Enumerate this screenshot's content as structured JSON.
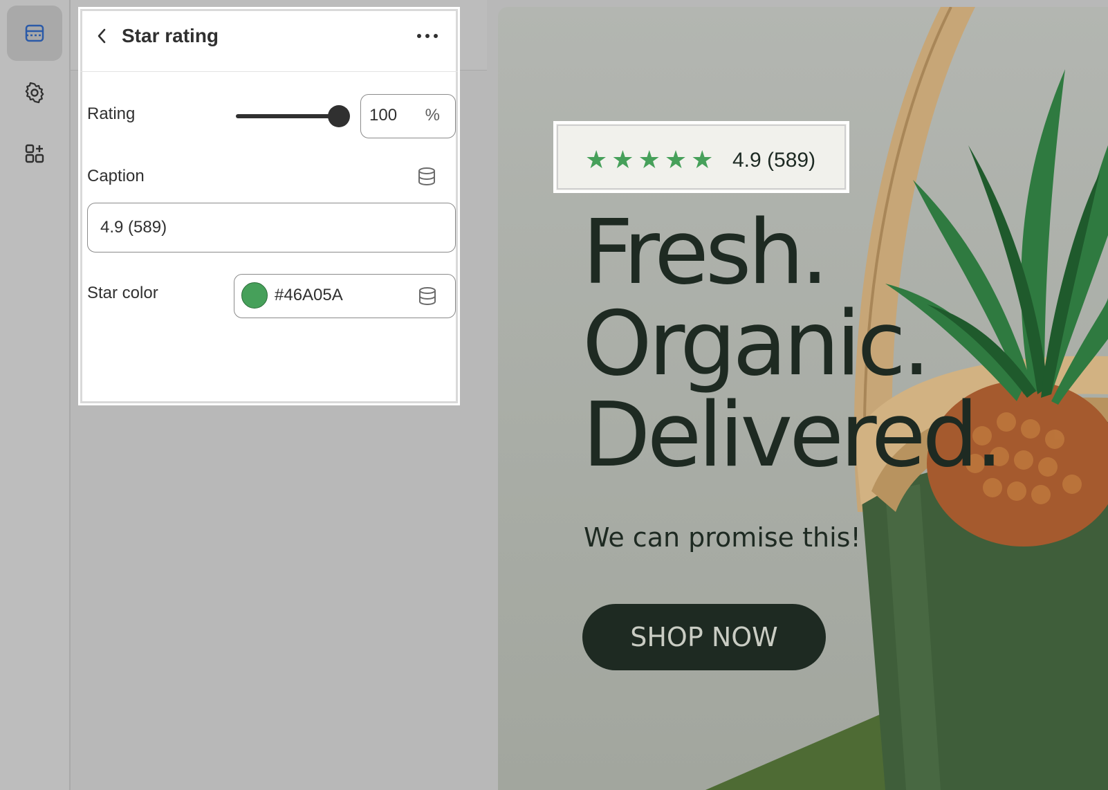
{
  "rail": {
    "items": [
      {
        "icon": "sections-icon",
        "active": true
      },
      {
        "icon": "gear-icon",
        "active": false
      },
      {
        "icon": "add-app-icon",
        "active": false
      }
    ]
  },
  "panel": {
    "title": "Star rating",
    "fields": {
      "rating": {
        "label": "Rating",
        "value": "100",
        "unit": "%",
        "slider_fraction": 1.0
      },
      "caption": {
        "label": "Caption",
        "value": "4.9 (589)"
      },
      "star_color": {
        "label": "Star color",
        "value": "#46A05A"
      }
    }
  },
  "preview": {
    "badge": {
      "star_count": 5,
      "star_color": "#46A05A",
      "text": "4.9 (589)"
    },
    "headline": {
      "line1": "Fresh.",
      "line2": "Organic.",
      "line3": "Delivered."
    },
    "subtext": "We can promise this!",
    "cta_label": "SHOP NOW"
  }
}
